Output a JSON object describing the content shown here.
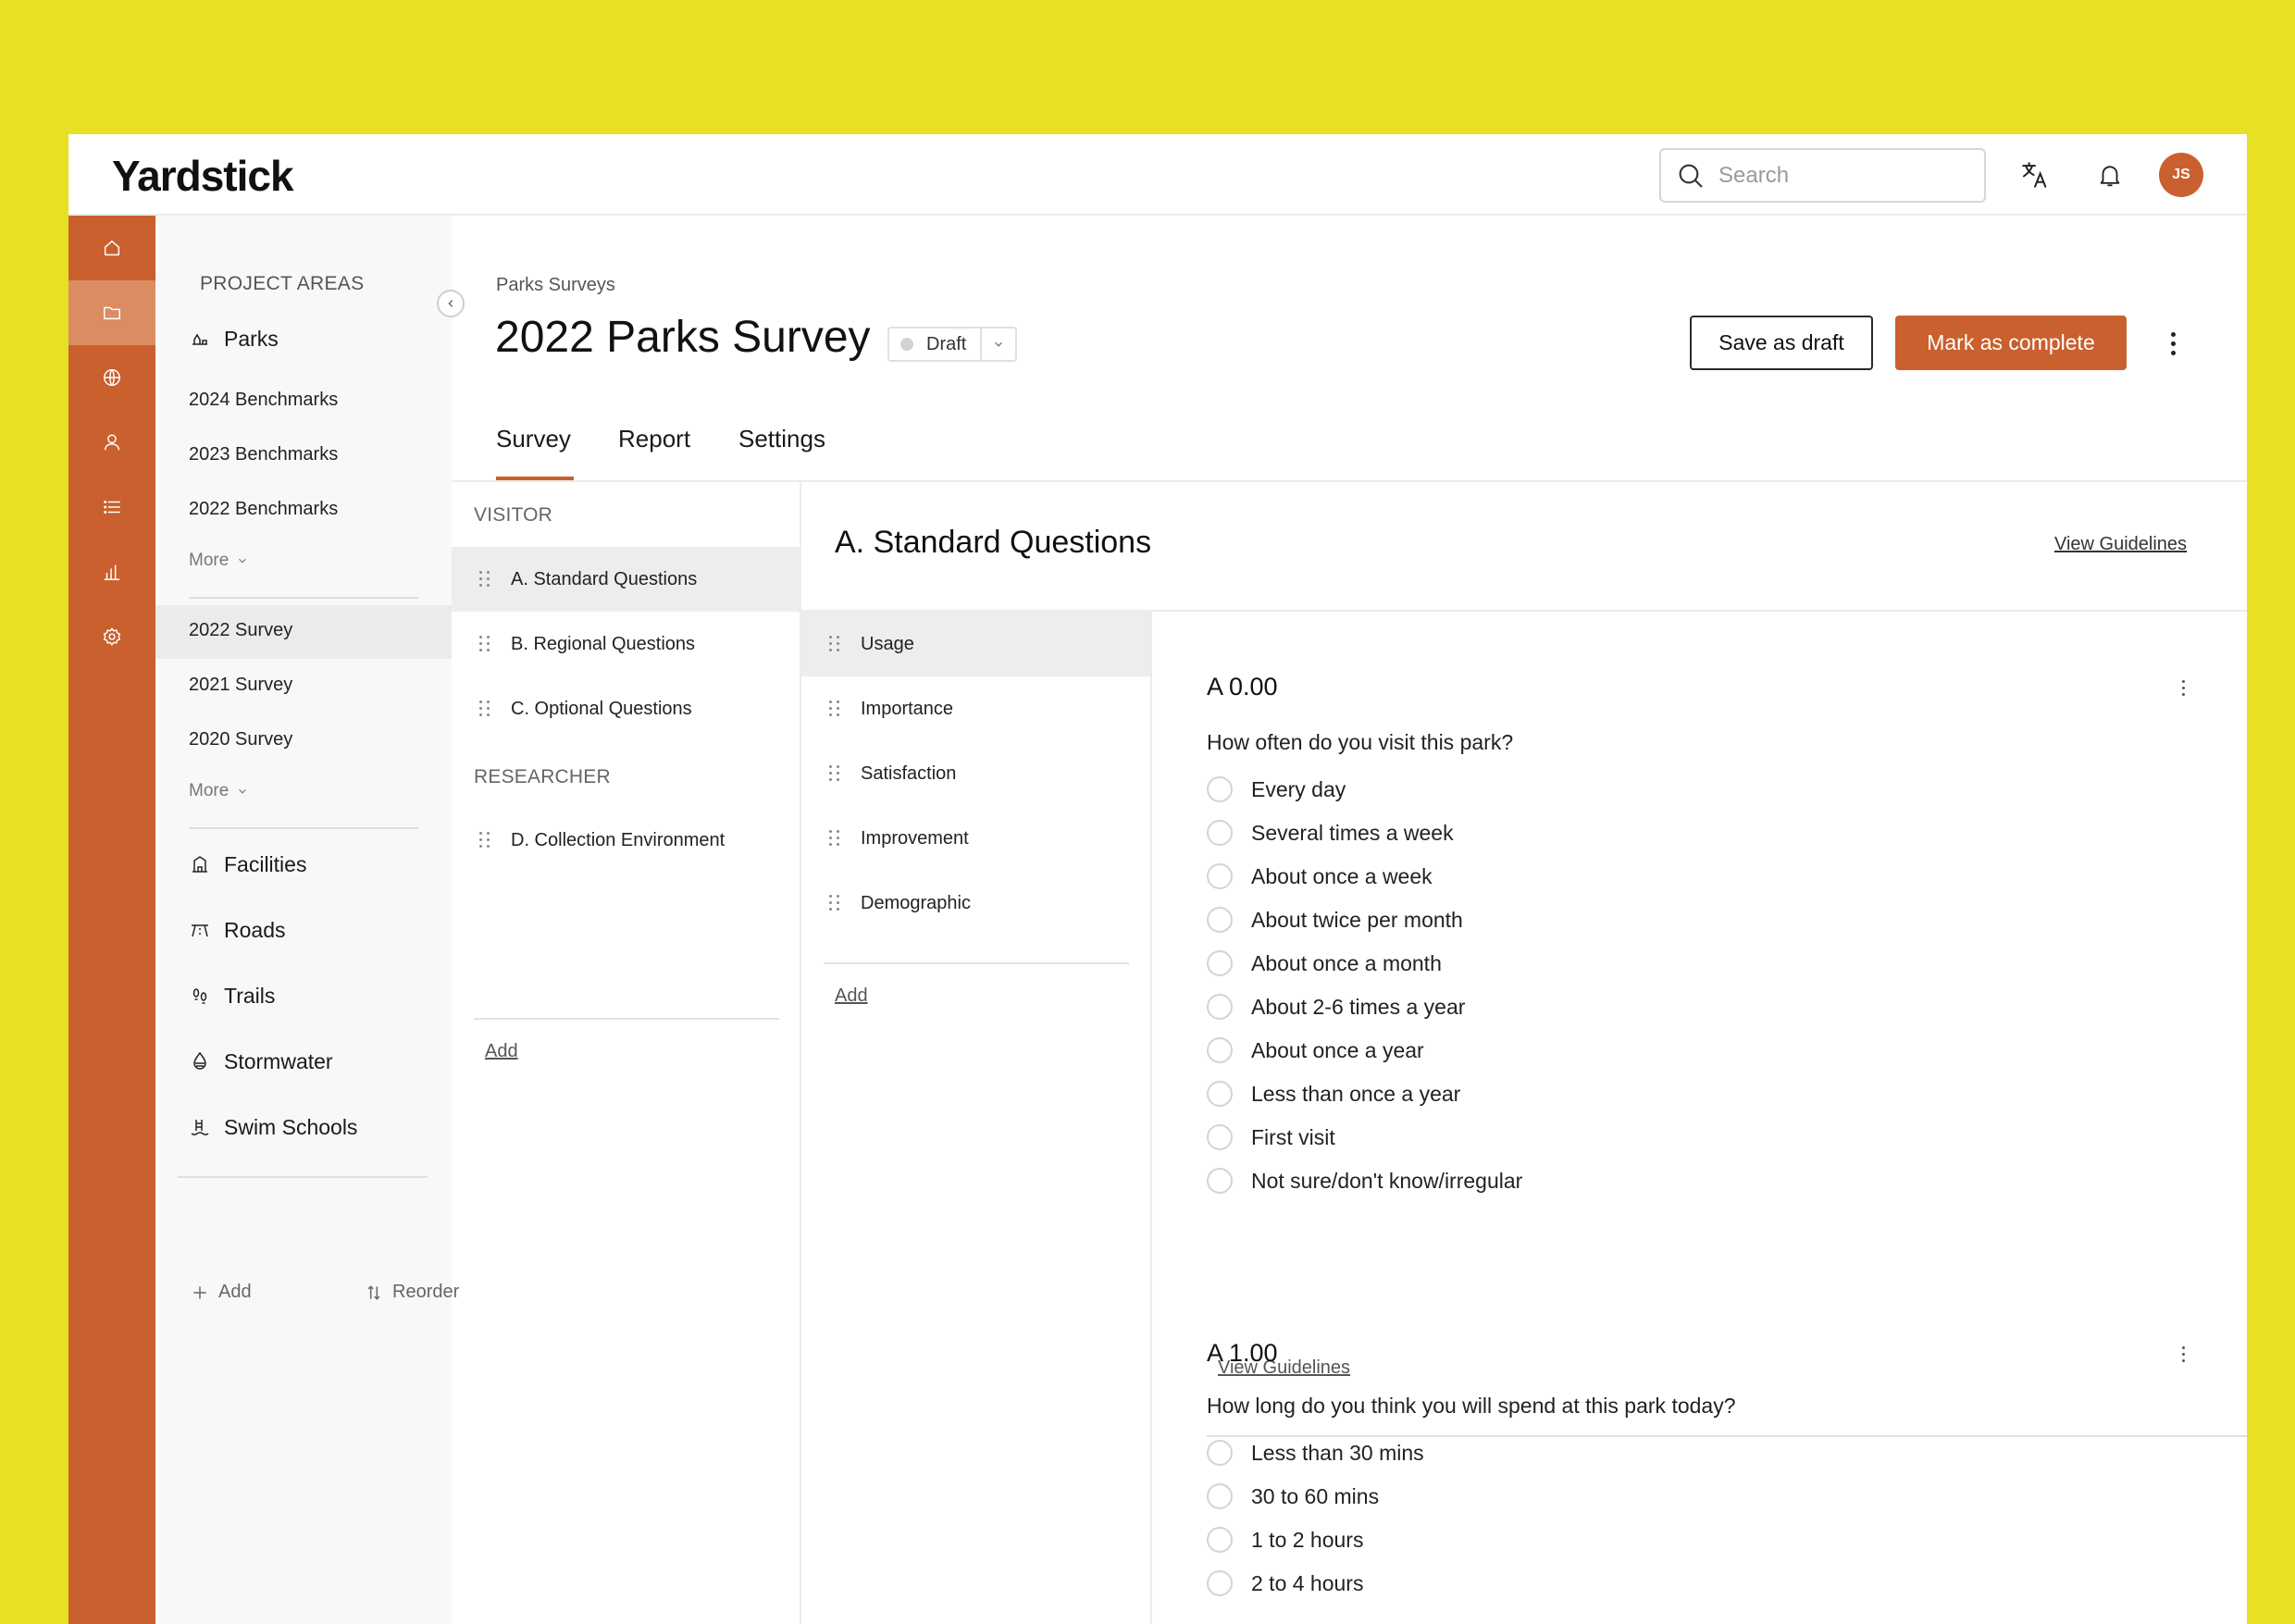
{
  "app": {
    "logo": "Yardstick",
    "brand_color": "#C9602E",
    "background_color": "#E8E024"
  },
  "header": {
    "search_placeholder": "Search",
    "translate_icon": "translate-icon",
    "notification_icon": "bell-icon",
    "avatar_initials": "JS"
  },
  "rail": {
    "items": [
      {
        "icon": "home-icon",
        "active": false
      },
      {
        "icon": "folder-icon",
        "active": true
      },
      {
        "icon": "globe-icon",
        "active": false
      },
      {
        "icon": "user-icon",
        "active": false
      },
      {
        "icon": "list-icon",
        "active": false
      },
      {
        "icon": "chart-icon",
        "active": false
      },
      {
        "icon": "settings-icon",
        "active": false
      }
    ]
  },
  "projects": {
    "heading": "PROJECT AREAS",
    "parks": "Parks",
    "benchmarks": [
      "2024 Benchmarks",
      "2023 Benchmarks",
      "2022 Benchmarks"
    ],
    "more_1": "More",
    "surveys": [
      "2022 Survey",
      "2021 Survey",
      "2020 Survey"
    ],
    "selected_survey": "2022 Survey",
    "more_2": "More",
    "areas": [
      "Facilities",
      "Roads",
      "Trails",
      "Stormwater",
      "Swim Schools"
    ],
    "add": "Add",
    "reorder": "Reorder"
  },
  "main": {
    "breadcrumb": "Parks Surveys",
    "title": "2022 Parks Survey",
    "status": "Draft",
    "save_draft": "Save as draft",
    "mark_complete": "Mark as complete",
    "tabs": [
      "Survey",
      "Report",
      "Settings"
    ],
    "active_tab": "Survey"
  },
  "sections": {
    "visitor_label": "VISITOR",
    "visitor_items": [
      "A. Standard Questions",
      "B. Regional Questions",
      "C. Optional Questions"
    ],
    "researcher_label": "RESEARCHER",
    "researcher_items": [
      "D. Collection Environment"
    ],
    "active": "A. Standard Questions",
    "add": "Add"
  },
  "content": {
    "section_title": "A. Standard Questions",
    "view_guidelines": "View Guidelines",
    "categories": [
      "Usage",
      "Importance",
      "Satisfaction",
      "Improvement",
      "Demographic"
    ],
    "active_category": "Usage",
    "categories_add": "Add",
    "questions": [
      {
        "number": "A 0.00",
        "text": "How often do you visit this park?",
        "options": [
          "Every day",
          "Several times a week",
          "About once a week",
          "About twice per month",
          "About once a month",
          "About 2-6 times a year",
          "About once a year",
          "Less than once a year",
          "First visit",
          "Not sure/don't know/irregular"
        ],
        "guidelines": "View Guidelines"
      },
      {
        "number": "A 1.00",
        "text": "How long do you think you will spend at this park today?",
        "options": [
          "Less than 30 mins",
          "30 to 60 mins",
          "1 to 2 hours",
          "2 to 4 hours"
        ]
      }
    ]
  }
}
